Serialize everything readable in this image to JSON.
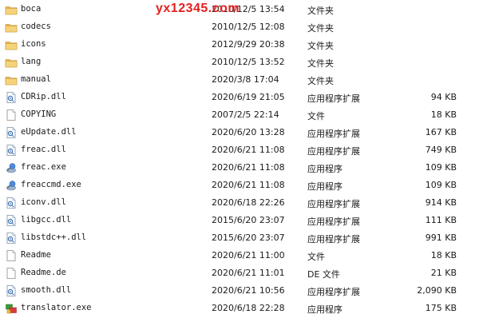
{
  "watermark": "yx12345.com",
  "files": [
    {
      "name": "boca",
      "date": "2010/12/5 13:54",
      "type": "文件夹",
      "size": "",
      "icon": "folder-icon"
    },
    {
      "name": "codecs",
      "date": "2010/12/5 12:08",
      "type": "文件夹",
      "size": "",
      "icon": "folder-icon"
    },
    {
      "name": "icons",
      "date": "2012/9/29 20:38",
      "type": "文件夹",
      "size": "",
      "icon": "folder-icon"
    },
    {
      "name": "lang",
      "date": "2010/12/5 13:52",
      "type": "文件夹",
      "size": "",
      "icon": "folder-icon"
    },
    {
      "name": "manual",
      "date": "2020/3/8 17:04",
      "type": "文件夹",
      "size": "",
      "icon": "folder-icon"
    },
    {
      "name": "CDRip.dll",
      "date": "2020/6/19 21:05",
      "type": "应用程序扩展",
      "size": "94 KB",
      "icon": "dll-icon"
    },
    {
      "name": "COPYING",
      "date": "2007/2/5 22:14",
      "type": "文件",
      "size": "18 KB",
      "icon": "file-icon"
    },
    {
      "name": "eUpdate.dll",
      "date": "2020/6/20 13:28",
      "type": "应用程序扩展",
      "size": "167 KB",
      "icon": "dll-icon"
    },
    {
      "name": "freac.dll",
      "date": "2020/6/21 11:08",
      "type": "应用程序扩展",
      "size": "749 KB",
      "icon": "dll-icon"
    },
    {
      "name": "freac.exe",
      "date": "2020/6/21 11:08",
      "type": "应用程序",
      "size": "109 KB",
      "icon": "freac-exe-icon"
    },
    {
      "name": "freaccmd.exe",
      "date": "2020/6/21 11:08",
      "type": "应用程序",
      "size": "109 KB",
      "icon": "freac-exe-icon"
    },
    {
      "name": "iconv.dll",
      "date": "2020/6/18 22:26",
      "type": "应用程序扩展",
      "size": "914 KB",
      "icon": "dll-icon"
    },
    {
      "name": "libgcc.dll",
      "date": "2015/6/20 23:07",
      "type": "应用程序扩展",
      "size": "111 KB",
      "icon": "dll-icon"
    },
    {
      "name": "libstdc++.dll",
      "date": "2015/6/20 23:07",
      "type": "应用程序扩展",
      "size": "991 KB",
      "icon": "dll-icon"
    },
    {
      "name": "Readme",
      "date": "2020/6/21 11:00",
      "type": "文件",
      "size": "18 KB",
      "icon": "file-icon"
    },
    {
      "name": "Readme.de",
      "date": "2020/6/21 11:01",
      "type": "DE 文件",
      "size": "21 KB",
      "icon": "file-icon"
    },
    {
      "name": "smooth.dll",
      "date": "2020/6/21 10:56",
      "type": "应用程序扩展",
      "size": "2,090 KB",
      "icon": "dll-icon"
    },
    {
      "name": "translator.exe",
      "date": "2020/6/18 22:28",
      "type": "应用程序",
      "size": "175 KB",
      "icon": "translator-exe-icon"
    }
  ]
}
